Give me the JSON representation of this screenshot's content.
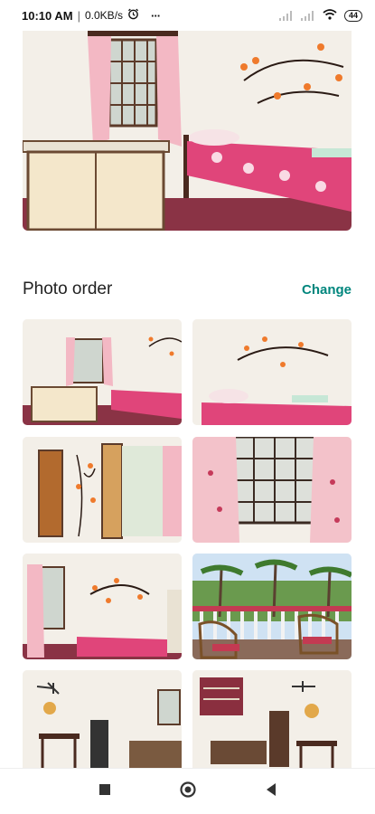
{
  "status_bar": {
    "time": "10:10 AM",
    "separator": "|",
    "network_speed": "0.0KB/s",
    "more": "···",
    "battery": "44"
  },
  "photo_order": {
    "title": "Photo order",
    "change_label": "Change"
  },
  "colors": {
    "accent": "#00867d",
    "bedspread": "#e0457a",
    "wall": "#f4f1ec",
    "floor": "#7a2a3a"
  },
  "icons": {
    "alarm": "alarm-clock-icon",
    "wifi": "wifi-icon",
    "signal": "signal-icon",
    "recents": "square-icon",
    "home": "circle-icon",
    "back": "triangle-back-icon"
  }
}
